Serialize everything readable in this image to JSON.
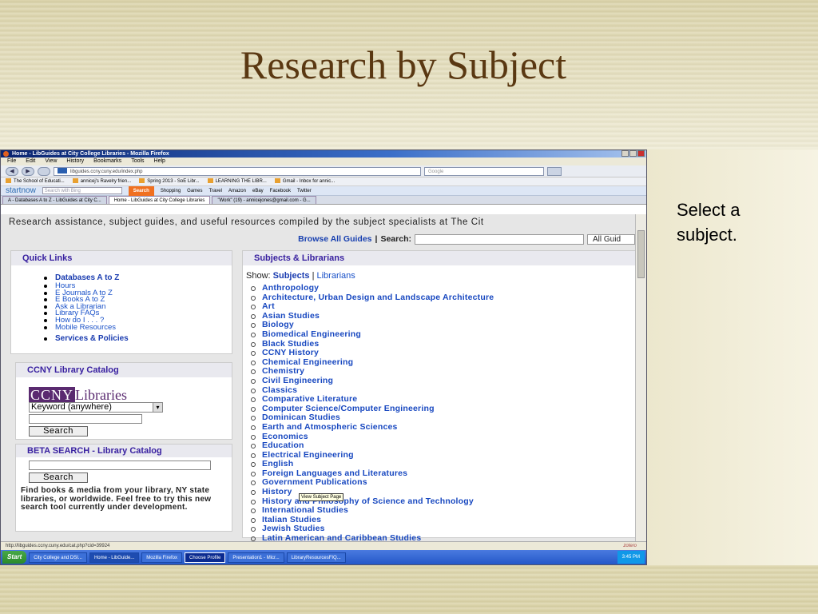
{
  "slide": {
    "title": "Research by Subject",
    "note": "Select a subject."
  },
  "window": {
    "title": "Home - LibGuides at City College Libraries - Mozilla Firefox"
  },
  "menu": [
    "File",
    "Edit",
    "View",
    "History",
    "Bookmarks",
    "Tools",
    "Help"
  ],
  "nav": {
    "url": "libguides.ccny.cuny.edu/index.php",
    "search_placeholder": "Google"
  },
  "bookmarks": [
    "The School of Educati...",
    "annicej's Ravelry frien...",
    "Spring 2013 - SoE Libr...",
    "LEARNING THE LIBR...",
    "Gmail - Inbox for annic..."
  ],
  "startnow": {
    "logo": "startnow",
    "placeholder": "Search with Bing",
    "search_label": "Search",
    "links": [
      "Shopping",
      "Games",
      "Travel",
      "Amazon",
      "eBay",
      "Facebook",
      "Twitter"
    ]
  },
  "tabs": [
    "A - Databases A to Z - LibGuides at City C...",
    "Home - LibGuides at City College Libraries",
    "\"Work\" (19) - annicejones@gmail.com - G..."
  ],
  "page": {
    "banner": "Research assistance, subject guides, and useful resources compiled by the subject specialists at The Cit",
    "browse_all": "Browse All Guides",
    "search_label": "Search:",
    "all_guides": "All Guid"
  },
  "quick_links": {
    "title": "Quick Links",
    "items": [
      "Databases A to Z",
      "Hours",
      "E Journals A to Z",
      "E Books A to Z",
      "Ask a Librarian",
      "Library FAQs",
      "How do I . . . ?",
      "Mobile Resources"
    ],
    "services": "Services & Policies"
  },
  "catalog": {
    "title": "CCNY Library Catalog",
    "logo_a": "CCNY",
    "logo_b": "Libraries",
    "select_value": "Keyword (anywhere)",
    "search_button": "Search"
  },
  "beta": {
    "title": "BETA SEARCH - Library Catalog",
    "search_button": "Search",
    "description": "Find books & media from your library, NY state libraries, or worldwide. Feel free to try this new search tool currently under development."
  },
  "subjects": {
    "title": "Subjects & Librarians",
    "show_label": "Show:",
    "show_subjects": "Subjects",
    "show_librarians": "Librarians",
    "tooltip": "View Subject Page",
    "items": [
      "Anthropology",
      "Architecture, Urban Design and Landscape Architecture",
      "Art",
      "Asian Studies",
      "Biology",
      "Biomedical Engineering",
      "Black Studies",
      "CCNY History",
      "Chemical Engineering",
      "Chemistry",
      "Civil Engineering",
      "Classics",
      "Comparative Literature",
      "Computer Science/Computer Engineering",
      "Dominican Studies",
      "Earth and Atmospheric Sciences",
      "Economics",
      "Education",
      "Electrical Engineering",
      "English",
      "Foreign Languages and Literatures",
      "Government Publications",
      "History",
      "History and Philosophy of Science and Technology",
      "International Studies",
      "Italian Studies",
      "Jewish Studies",
      "Latin American and Caribbean Studies"
    ]
  },
  "status": {
    "url": "http://libguides.ccny.cuny.edu/cat.php?cid=39924",
    "zotero": "zotero"
  },
  "taskbar": {
    "start": "Start",
    "tasks": [
      "City College and DSI...",
      "Home - LibGuide...",
      "Mozilla Firefox",
      "Choose Profile",
      "Presentation1 - Micr...",
      "LibraryResourcesFIQ..."
    ],
    "clock": "3:45 PM"
  }
}
